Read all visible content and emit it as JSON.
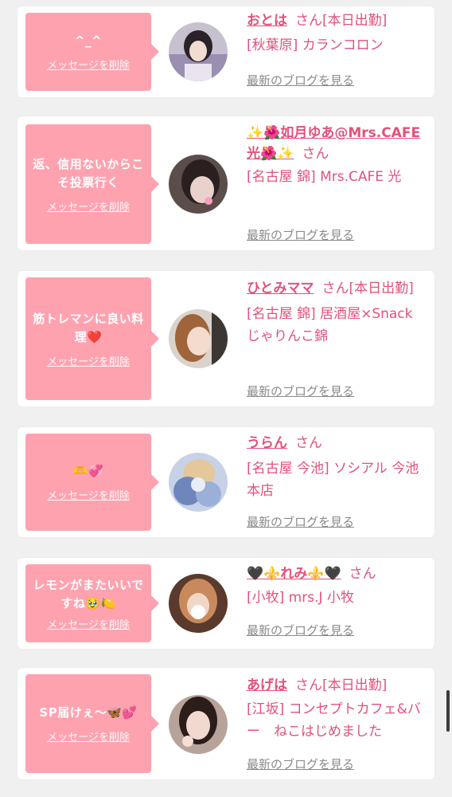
{
  "entries": [
    {
      "message": "^_^",
      "delete_label": "メッセージを削除",
      "name": "おとは",
      "honorific": "さん",
      "status": "[本日出勤]",
      "shop": "[秋葉原] カランコロン",
      "blog_label": "最新のブログを見る"
    },
    {
      "message": "返、信用ないからこそ投票行く",
      "delete_label": "メッセージを削除",
      "name": "✨🌺如月ゆあ@Mrs.CAFE光🌺✨",
      "honorific": "さん",
      "status": "",
      "shop": "[名古屋 錦] Mrs.CAFE 光",
      "blog_label": "最新のブログを見る"
    },
    {
      "message": "筋トレマンに良い料理❤️",
      "delete_label": "メッセージを削除",
      "name": "ひとみママ",
      "honorific": "さん",
      "status": "[本日出勤]",
      "shop": "[名古屋 錦] 居酒屋×Snack じゃりんこ錦",
      "blog_label": "最新のブログを見る"
    },
    {
      "message": "🫶💞",
      "delete_label": "メッセージを削除",
      "name": "うらん",
      "honorific": "さん",
      "status": "",
      "shop": "[名古屋 今池] ソシアル 今池本店",
      "blog_label": "最新のブログを見る"
    },
    {
      "message": "レモンがまたいいですね🥹🍋",
      "delete_label": "メッセージを削除",
      "name": "🖤⚜️れみ⚜️🖤",
      "honorific": "さん",
      "status": "",
      "shop": "[小牧] mrs.J 小牧",
      "blog_label": "最新のブログを見る"
    },
    {
      "message": "SP届けぇ〜🦋💕",
      "delete_label": "メッセージを削除",
      "name": "あげは",
      "honorific": "さん",
      "status": "[本日出勤]",
      "shop": "[江坂] コンセプトカフェ&バー　ねこはじめました",
      "blog_label": "最新のブログを見る"
    }
  ],
  "colors": {
    "accent": "#e2527b",
    "bubble": "#ffa2b0",
    "muted": "#8a8a8a"
  }
}
